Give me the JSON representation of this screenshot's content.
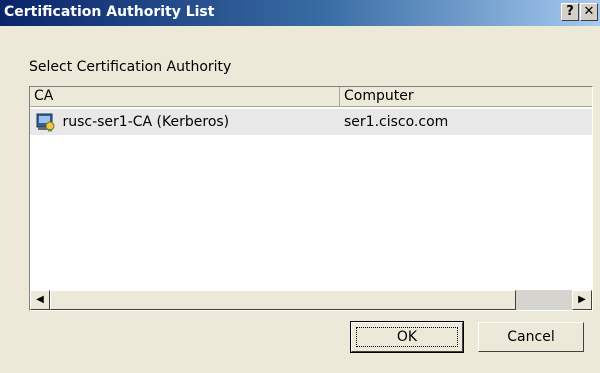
{
  "window": {
    "title": "Certification Authority List",
    "help_label": "?",
    "close_label": "✕"
  },
  "prompt": "Select Certification Authority",
  "list": {
    "columns": [
      "CA",
      "Computer"
    ],
    "rows": [
      {
        "ca": "rusc-ser1-CA (Kerberos)",
        "computer": "ser1.cisco.com",
        "icon": "certificate-server-icon"
      }
    ]
  },
  "scrollbar": {
    "left_arrow": "◀",
    "right_arrow": "▶"
  },
  "buttons": {
    "ok": "OK",
    "cancel": "Cancel"
  }
}
